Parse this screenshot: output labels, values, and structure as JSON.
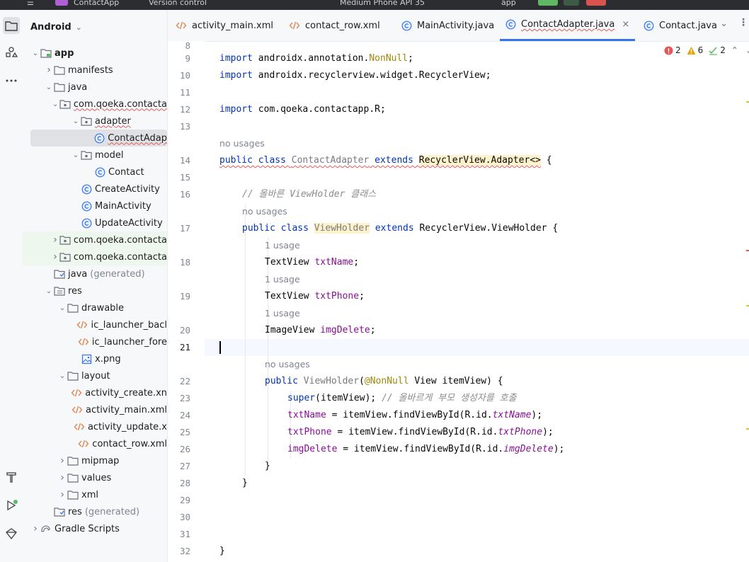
{
  "titlebar": {
    "left_text": "ContactApp",
    "vcs_text": "Version control",
    "device_text": "Medium Phone API 35",
    "run_config": "app"
  },
  "project_panel": {
    "view_label": "Android",
    "tree": [
      {
        "label": "app",
        "icon": "module-folder-icon",
        "level": 0,
        "arrow": "down",
        "bold": true
      },
      {
        "label": "manifests",
        "icon": "folder-icon",
        "level": 1,
        "arrow": "right"
      },
      {
        "label": "java",
        "icon": "folder-icon",
        "level": 1,
        "arrow": "down"
      },
      {
        "label": "com.qoeka.contacta",
        "icon": "package-icon",
        "level": 2,
        "arrow": "down",
        "squiggle": true
      },
      {
        "label": "adapter",
        "icon": "package-icon",
        "level": 3,
        "arrow": "down",
        "squiggle": true
      },
      {
        "label": "ContactAdap",
        "icon": "class-icon",
        "level": 4,
        "arrow": "none",
        "selected": true,
        "squiggle": true
      },
      {
        "label": "model",
        "icon": "package-icon",
        "level": 3,
        "arrow": "down"
      },
      {
        "label": "Contact",
        "icon": "class-icon",
        "level": 4,
        "arrow": "none"
      },
      {
        "label": "CreateActivity",
        "icon": "class-icon",
        "level": 3,
        "arrow": "none"
      },
      {
        "label": "MainActivity",
        "icon": "class-icon",
        "level": 3,
        "arrow": "none"
      },
      {
        "label": "UpdateActivity",
        "icon": "class-icon",
        "level": 3,
        "arrow": "none"
      },
      {
        "label": "com.qoeka.contacta",
        "icon": "package-icon",
        "level": 2,
        "arrow": "right",
        "green": true
      },
      {
        "label": "com.qoeka.contacta",
        "icon": "package-icon",
        "level": 2,
        "arrow": "right",
        "green": true
      },
      {
        "label": "java",
        "suffix": "(generated)",
        "icon": "generated-folder-icon",
        "level": 1,
        "arrow": "none"
      },
      {
        "label": "res",
        "icon": "res-folder-icon",
        "level": 1,
        "arrow": "down"
      },
      {
        "label": "drawable",
        "icon": "folder-icon",
        "level": 2,
        "arrow": "down"
      },
      {
        "label": "ic_launcher_bacl",
        "icon": "xml-icon",
        "level": 3,
        "arrow": "none"
      },
      {
        "label": "ic_launcher_fore",
        "icon": "xml-icon",
        "level": 3,
        "arrow": "none"
      },
      {
        "label": "x.png",
        "icon": "image-icon",
        "level": 3,
        "arrow": "none"
      },
      {
        "label": "layout",
        "icon": "folder-icon",
        "level": 2,
        "arrow": "down"
      },
      {
        "label": "activity_create.xn",
        "icon": "xml-icon",
        "level": 3,
        "arrow": "none"
      },
      {
        "label": "activity_main.xml",
        "icon": "xml-icon",
        "level": 3,
        "arrow": "none"
      },
      {
        "label": "activity_update.x",
        "icon": "xml-icon",
        "level": 3,
        "arrow": "none"
      },
      {
        "label": "contact_row.xml",
        "icon": "xml-icon",
        "level": 3,
        "arrow": "none"
      },
      {
        "label": "mipmap",
        "icon": "folder-icon",
        "level": 2,
        "arrow": "right"
      },
      {
        "label": "values",
        "icon": "folder-icon",
        "level": 2,
        "arrow": "right"
      },
      {
        "label": "xml",
        "icon": "folder-icon",
        "level": 2,
        "arrow": "right"
      },
      {
        "label": "res",
        "suffix": "(generated)",
        "icon": "generated-folder-icon",
        "level": 1,
        "arrow": "none"
      },
      {
        "label": "Gradle Scripts",
        "icon": "gradle-icon",
        "level": 0,
        "arrow": "right"
      }
    ]
  },
  "tabs": [
    {
      "label": "activity_main.xml",
      "icon": "xml-icon"
    },
    {
      "label": "contact_row.xml",
      "icon": "xml-icon"
    },
    {
      "label": "MainActivity.java",
      "icon": "class-icon"
    },
    {
      "label": "ContactAdapter.java",
      "icon": "class-icon",
      "active": true,
      "close": "×"
    },
    {
      "label": "Contact.java",
      "icon": "class-icon"
    }
  ],
  "inspections": {
    "errors": "2",
    "warnings": "6",
    "weak_warnings": "2"
  },
  "editor": {
    "line_numbers": [
      "8",
      "9",
      "10",
      "11",
      "12",
      "13",
      "14",
      "15",
      "16",
      "17",
      "18",
      "19",
      "20",
      "21",
      "22",
      "23",
      "24",
      "25",
      "26",
      "27",
      "28",
      "29",
      "30",
      "31",
      "32"
    ],
    "current_line": "21",
    "hints": {
      "h14": "no usages",
      "h17": "no usages",
      "h18": "1 usage",
      "h19": "1 usage",
      "h20": "1 usage",
      "h22": "no usages"
    },
    "code": {
      "l9a": "import ",
      "l9b": "androidx.annotation.",
      "l9c": "NonNull",
      "l9d": ";",
      "l10a": "import ",
      "l10b": "androidx.recyclerview.widget.RecyclerView;",
      "l12a": "import ",
      "l12b": "com.qoeka.contactapp.R;",
      "l14a": "public class ",
      "l14b": "ContactAdapter",
      "l14c": " extends ",
      "l14d": "RecyclerView.Adapter<>",
      "l14e": " {",
      "l16": "// 올바른 ViewHolder 클래스",
      "l17a": "public class ",
      "l17b": "ViewHolder",
      "l17c": " extends ",
      "l17d": "RecyclerView.ViewHolder {",
      "l18a": "TextView ",
      "l18b": "txtName",
      "l18c": ";",
      "l19a": "TextView ",
      "l19b": "txtPhone",
      "l19c": ";",
      "l20a": "ImageView ",
      "l20b": "imgDelete",
      "l20c": ";",
      "l22a": "public ",
      "l22b": "ViewHolder",
      "l22c": "(",
      "l22d": "@NonNull",
      "l22e": " View itemView) {",
      "l23a": "super",
      "l23b": "(itemView); ",
      "l23c": "// 올바르게 부모 생성자를 호출",
      "l24a": "txtName",
      "l24b": " = itemView.findViewById(R.id.",
      "l24c": "txtName",
      "l24d": ");",
      "l25a": "txtPhone",
      "l25b": " = itemView.findViewById(R.id.",
      "l25c": "txtPhone",
      "l25d": ");",
      "l26a": "imgDelete",
      "l26b": " = itemView.findViewById(R.id.",
      "l26c": "imgDelete",
      "l26d": ");",
      "l27": "}",
      "l28": "}",
      "l32": "}"
    }
  },
  "colors": {
    "accent": "#3574f0",
    "error": "#e55757",
    "warning": "#e5a50a",
    "keyword": "#0033b3",
    "field": "#871094"
  }
}
